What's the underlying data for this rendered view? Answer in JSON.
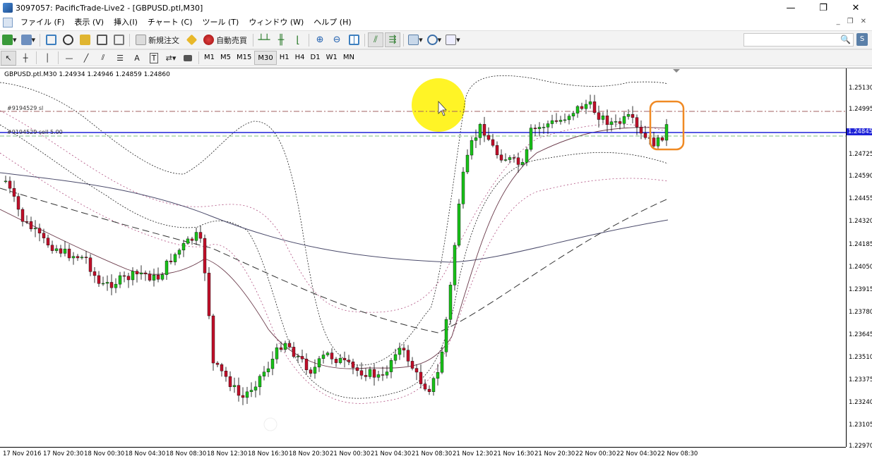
{
  "window": {
    "title": "3097057: PacificTrade-Live2 - [GBPUSD.ptl,M30]",
    "minimize": "—",
    "maximize": "❐",
    "close": "✕"
  },
  "menu": [
    "ファイル (F)",
    "表示 (V)",
    "挿入(I)",
    "チャート (C)",
    "ツール (T)",
    "ウィンドウ (W)",
    "ヘルプ (H)"
  ],
  "mdi_controls": {
    "minimize": "_",
    "restore": "❐",
    "close": "✕"
  },
  "toolbar": {
    "new_order": "新規注文",
    "auto_trading": "自動売買"
  },
  "drawing_tools": {
    "text_tool": "A",
    "text_label_tool": "T"
  },
  "timeframes": [
    "M1",
    "M5",
    "M15",
    "M30",
    "H1",
    "H4",
    "D1",
    "W1",
    "MN"
  ],
  "active_timeframe": "M30",
  "search": {
    "placeholder": "",
    "icon": "🔍"
  },
  "chart": {
    "header": "GBPUSD.ptl.M30  1.24934 1.24946 1.24859 1.24860",
    "order_sl": "#9194529 sl",
    "order_sell": "#9194529 sell 5.00",
    "current_price": "1.24845",
    "price_labels": [
      "1.25130",
      "1.24995",
      "1.24725",
      "1.24590",
      "1.24455",
      "1.24320",
      "1.24185",
      "1.24050",
      "1.23915",
      "1.23780",
      "1.23645",
      "1.23510",
      "1.23375",
      "1.23240",
      "1.23105",
      "1.22970"
    ],
    "time_labels": [
      "17 Nov 2016",
      "17 Nov 20:30",
      "18 Nov 00:30",
      "18 Nov 04:30",
      "18 Nov 08:30",
      "18 Nov 12:30",
      "18 Nov 16:30",
      "18 Nov 20:30",
      "21 Nov 00:30",
      "21 Nov 04:30",
      "21 Nov 08:30",
      "21 Nov 12:30",
      "21 Nov 16:30",
      "21 Nov 20:30",
      "22 Nov 00:30",
      "22 Nov 04:30",
      "22 Nov 08:30"
    ],
    "colors": {
      "bull": "#19c119",
      "bear": "#c0102a",
      "price_line": "#1e22d8",
      "sl_line": "#a06060",
      "highlight": "#f08a24",
      "cursor_highlight": "#fff200"
    }
  }
}
